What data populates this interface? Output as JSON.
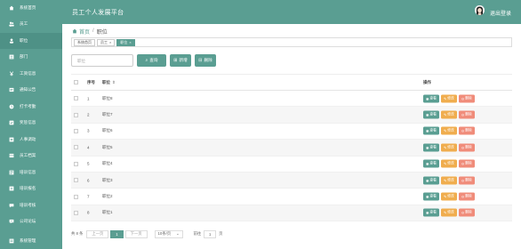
{
  "header": {
    "title": "员工个人发展平台",
    "user_name": "退出登录"
  },
  "sidebar": {
    "items": [
      {
        "label": "系统首页",
        "icon": "home-icon"
      },
      {
        "label": "员工",
        "icon": "users-icon"
      },
      {
        "label": "职位",
        "icon": "user-icon"
      },
      {
        "label": "部门",
        "icon": "department-icon"
      },
      {
        "label": "工资信息",
        "icon": "money-icon"
      },
      {
        "label": "通知公告",
        "icon": "notice-icon"
      },
      {
        "label": "打卡考勤",
        "icon": "clock-icon"
      },
      {
        "label": "奖惩信息",
        "icon": "reward-icon"
      },
      {
        "label": "人事调动",
        "icon": "transfer-icon"
      },
      {
        "label": "员工档案",
        "icon": "archive-icon"
      },
      {
        "label": "培训信息",
        "icon": "training-icon"
      },
      {
        "label": "培训报名",
        "icon": "signup-icon"
      },
      {
        "label": "培训考核",
        "icon": "exam-icon"
      },
      {
        "label": "公司论坛",
        "icon": "forum-icon"
      },
      {
        "label": "系统管理",
        "icon": "settings-icon"
      }
    ]
  },
  "breadcrumb": {
    "home": "首页",
    "separator": "/",
    "current": "职位"
  },
  "tabs": [
    {
      "label": "系统首页",
      "closable": false,
      "active": false
    },
    {
      "label": "员工",
      "closable": true,
      "active": false
    },
    {
      "label": "职位",
      "closable": true,
      "active": true
    }
  ],
  "toolbar": {
    "search_placeholder": "职位",
    "search_label": "查询",
    "add_label": "新增",
    "delete_label": "删除"
  },
  "table": {
    "columns": [
      "序号",
      "职位",
      "操作"
    ],
    "rows": [
      {
        "index": "1",
        "name": "职位8"
      },
      {
        "index": "2",
        "name": "职位7"
      },
      {
        "index": "3",
        "name": "职位6"
      },
      {
        "index": "4",
        "name": "职位5"
      },
      {
        "index": "5",
        "name": "职位4"
      },
      {
        "index": "6",
        "name": "职位3"
      },
      {
        "index": "7",
        "name": "职位2"
      },
      {
        "index": "8",
        "name": "职位1"
      }
    ],
    "actions": {
      "view": "查看",
      "edit": "修改",
      "delete": "删除"
    }
  },
  "pager": {
    "total": "共 8 条",
    "prev": "上一页",
    "current_page": "1",
    "next": "下一页",
    "page_size": "10条/页",
    "goto_label": "前往",
    "goto_value": "1",
    "goto_suffix": "页"
  },
  "colors": {
    "primary": "#5a9e92",
    "edit": "#f0ad4e",
    "delete": "#f08c7a"
  }
}
